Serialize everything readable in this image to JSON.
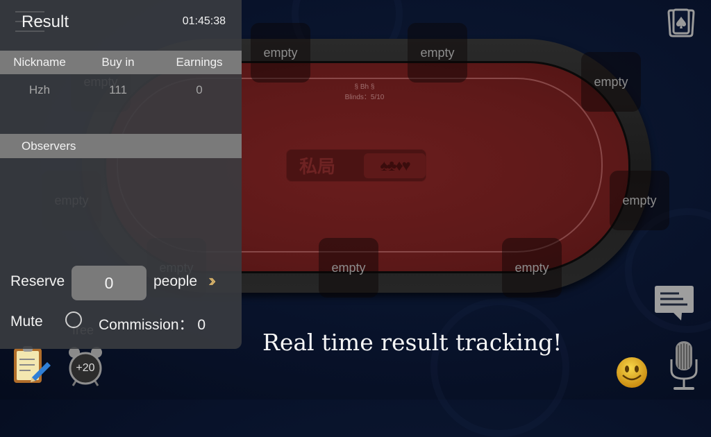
{
  "table": {
    "name": "§ Bh §",
    "blinds": "Blinds：5/10",
    "logo_text": "私局",
    "logo_suits": "♠♣♦♥",
    "seats": [
      {
        "label": "empty"
      },
      {
        "label": "empty"
      },
      {
        "label": "empty"
      },
      {
        "label": "empty"
      },
      {
        "label": "empty"
      },
      {
        "label": "empty"
      },
      {
        "label": "empty"
      },
      {
        "label": "empty"
      },
      {
        "label": "empty"
      }
    ],
    "free_label": "free",
    "clock_bonus": "+20"
  },
  "result_panel": {
    "title": "Result",
    "timer": "01:45:38",
    "columns": [
      "Nickname",
      "Buy in",
      "Earnings"
    ],
    "rows": [
      {
        "nickname": "Hzh",
        "buy_in": "111",
        "earnings": "0"
      }
    ],
    "observers_label": "Observers",
    "reserve_label": "Reserve",
    "reserve_value": "0",
    "people_label": "people",
    "more_icon": "»",
    "mute_label": "Mute",
    "mute_checked": false,
    "commission_label": "Commission：",
    "commission_value": "0"
  },
  "caption": "Real time result tracking!",
  "icons": {
    "cards": "card-deck-icon",
    "chat": "chat-icon",
    "emoji": "emoji-icon",
    "mic": "microphone-icon",
    "notes": "notepad-icon",
    "clock": "alarm-clock-icon"
  },
  "colors": {
    "felt": "#5e1919",
    "background": "#08122a",
    "accent_chevron": "#d9b46a"
  }
}
